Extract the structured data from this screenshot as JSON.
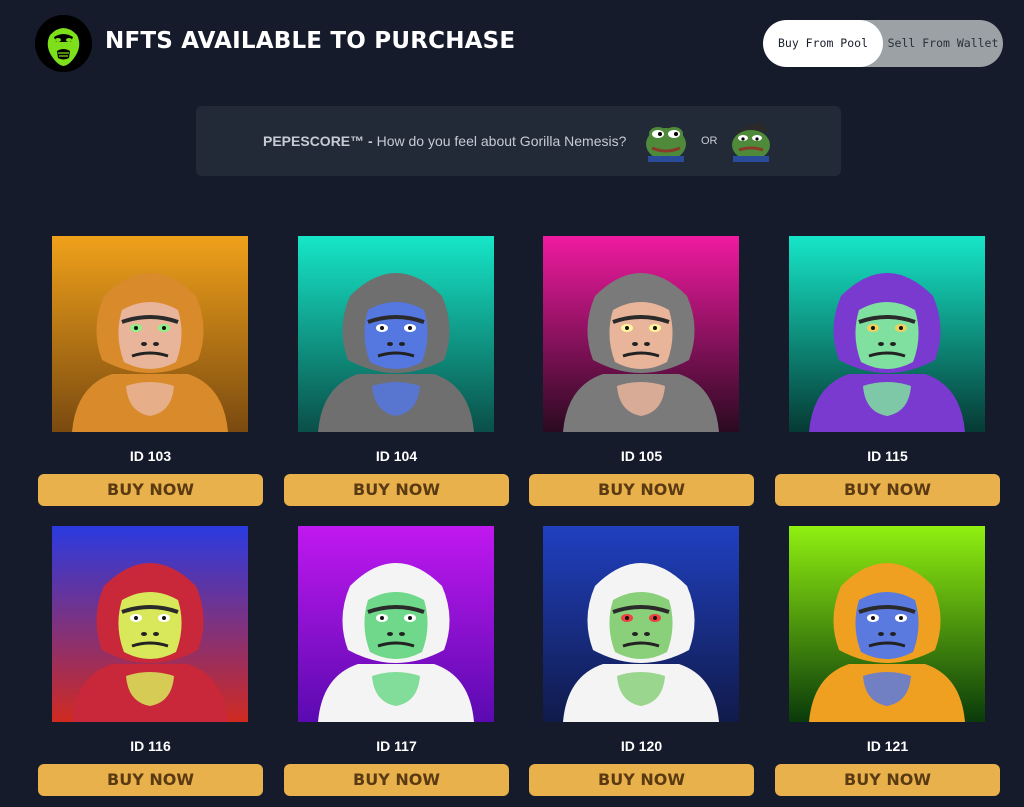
{
  "header": {
    "title": "NFTS AVAILABLE TO PURCHASE",
    "toggle": {
      "buy_label": "Buy From Pool",
      "sell_label": "Sell From Wallet",
      "active": "buy"
    }
  },
  "pepescore": {
    "brand": "PEPESCORE™ -",
    "question": "How do you feel about Gorilla Nemesis?",
    "or_label": "OR",
    "happy_icon": "happy-pepe-icon",
    "sad_icon": "sad-pepe-icon"
  },
  "colors": {
    "background": "#161b2b",
    "panel": "#222a38",
    "buy_button": "#e9b14b",
    "buy_text": "#5a3a12"
  },
  "nfts": [
    {
      "id_label": "ID 103",
      "button": "BUY NOW",
      "bg": [
        "#f0a11a",
        "#7a4a10"
      ],
      "fur": "#d98a2a",
      "face": "#e8b49a",
      "eye": "#8ff08a"
    },
    {
      "id_label": "ID 104",
      "button": "BUY NOW",
      "bg": [
        "#16e6c8",
        "#0a4f48"
      ],
      "fur": "#6f6f6f",
      "face": "#5577e0",
      "eye": "#ffffff"
    },
    {
      "id_label": "ID 105",
      "button": "BUY NOW",
      "bg": [
        "#f01aa0",
        "#2a0a20"
      ],
      "fur": "#7a7a7a",
      "face": "#e8b49a",
      "eye": "#fff4a0"
    },
    {
      "id_label": "ID 115",
      "button": "BUY NOW",
      "bg": [
        "#16e6c8",
        "#063a34"
      ],
      "fur": "#7a3ad0",
      "face": "#7fe0a0",
      "eye": "#f0d060"
    },
    {
      "id_label": "ID 116",
      "button": "BUY NOW",
      "bg": [
        "#2a3ae0",
        "#d02a20"
      ],
      "fur": "#c8283a",
      "face": "#d8e85a",
      "eye": "#ffffff"
    },
    {
      "id_label": "ID 117",
      "button": "BUY NOW",
      "bg": [
        "#c018f0",
        "#5a0ab0"
      ],
      "fur": "#f4f4f4",
      "face": "#6fd88a",
      "eye": "#ffffff"
    },
    {
      "id_label": "ID 120",
      "button": "BUY NOW",
      "bg": [
        "#2040c0",
        "#101a4a"
      ],
      "fur": "#f4f4f4",
      "face": "#8ad07a",
      "eye": "#f04040"
    },
    {
      "id_label": "ID 121",
      "button": "BUY NOW",
      "bg": [
        "#90f010",
        "#0a3a0a"
      ],
      "fur": "#f0a020",
      "face": "#5a7ae0",
      "eye": "#ffffff"
    }
  ]
}
